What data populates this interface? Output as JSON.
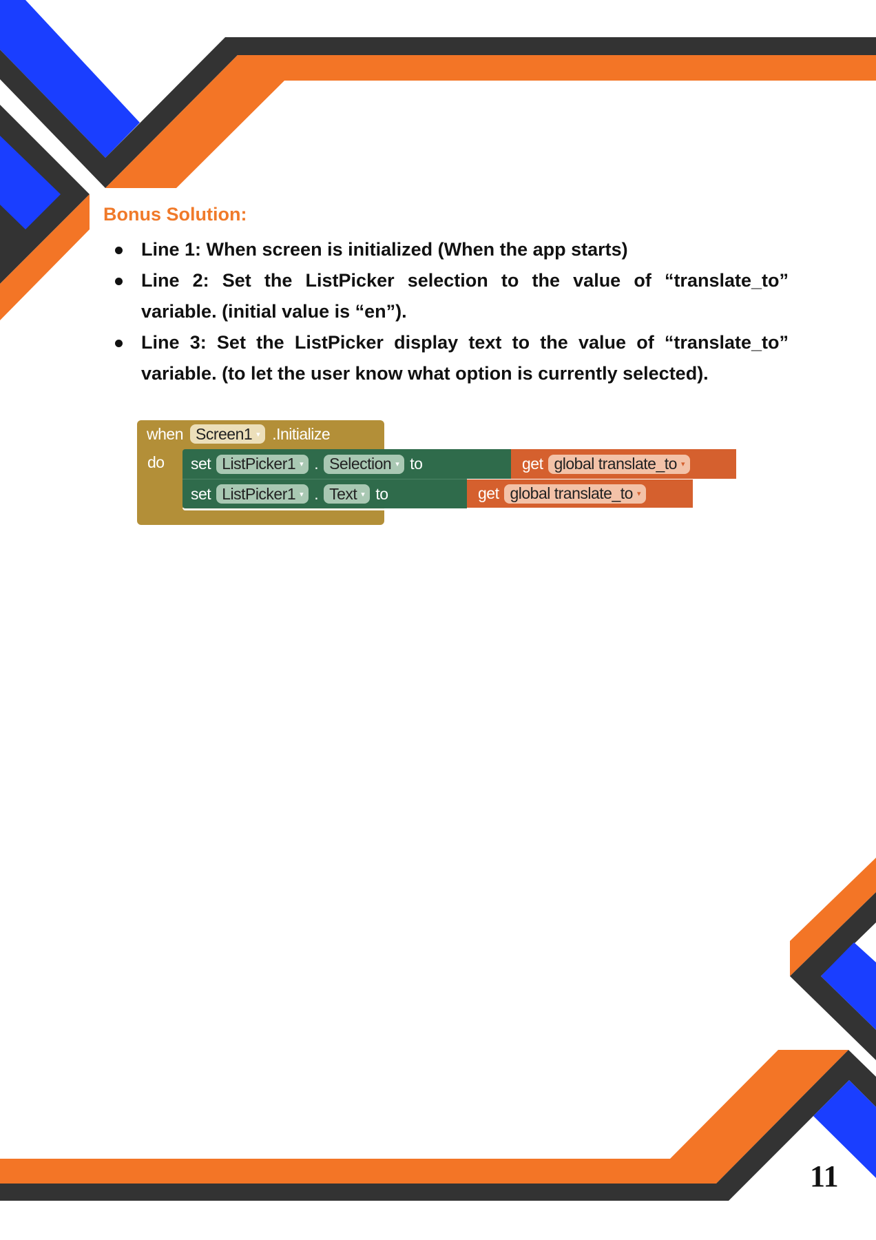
{
  "heading": "Bonus Solution:",
  "bullets": [
    {
      "text": "Line 1: When screen is initialized (When the app starts)"
    },
    {
      "text": "Line 2: Set the ListPicker selection to the value of “translate_to” variable. (initial value is “en”)."
    },
    {
      "text": "Line 3: Set the ListPicker display text to the value of “translate_to” variable. (to let the user know what option is currently selected)."
    }
  ],
  "blocks": {
    "when": "when",
    "component": "Screen1",
    "event": ".Initialize",
    "do": "do",
    "rows": [
      {
        "set": "set",
        "component": "ListPicker1",
        "dot": ".",
        "property": "Selection",
        "to": "to",
        "get": "get",
        "variable": "global translate_to"
      },
      {
        "set": "set",
        "component": "ListPicker1",
        "dot": ".",
        "property": "Text",
        "to": "to",
        "get": "get",
        "variable": "global translate_to"
      }
    ],
    "dropdown_glyph": "▾"
  },
  "page_number": "11",
  "colors": {
    "orange": "#f37526",
    "dark": "#333333",
    "blue": "#1a3eff",
    "event_block": "#b38f38",
    "set_block": "#2f6b4b",
    "get_block": "#d5602e"
  }
}
